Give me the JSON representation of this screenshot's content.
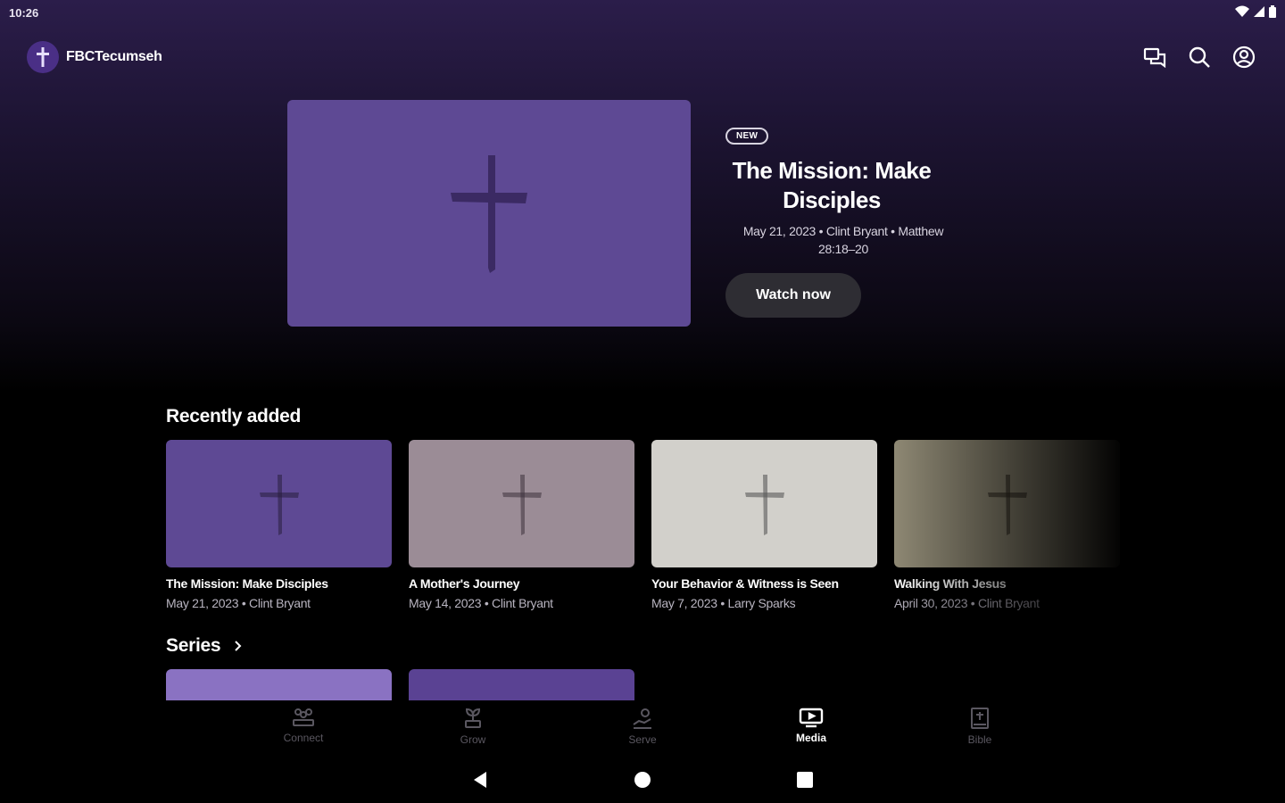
{
  "status_bar": {
    "time": "10:26"
  },
  "app": {
    "name": "FBCTecumseh"
  },
  "top_actions": [
    "messages-icon",
    "search-icon",
    "account-icon"
  ],
  "hero": {
    "badge": "NEW",
    "title": "The Mission: Make Disciples",
    "meta": "May 21, 2023 • Clint Bryant • Matthew 28:18–20",
    "cta": "Watch now",
    "thumb_color": "#5e4994"
  },
  "recently_added": {
    "title": "Recently added",
    "items": [
      {
        "title": "The Mission: Make Disciples",
        "meta": "May 21, 2023 • Clint Bryant",
        "color": "#5e4994"
      },
      {
        "title": "A Mother's Journey",
        "meta": "May 14, 2023 • Clint Bryant",
        "color": "#9b8c96"
      },
      {
        "title": "Your Behavior & Witness is Seen",
        "meta": "May 7, 2023 • Larry Sparks",
        "color": "#d2d0cb"
      },
      {
        "title": "Walking With Jesus",
        "meta": "April 30, 2023 • Clint Bryant",
        "color": "#918b76"
      }
    ]
  },
  "series": {
    "title": "Series",
    "colors": [
      "#8a72c2",
      "#5a4293"
    ]
  },
  "bottom_nav": {
    "items": [
      {
        "label": "Connect",
        "icon": "connect-icon"
      },
      {
        "label": "Grow",
        "icon": "grow-icon"
      },
      {
        "label": "Serve",
        "icon": "serve-icon"
      },
      {
        "label": "Media",
        "icon": "media-icon",
        "active": true
      },
      {
        "label": "Bible",
        "icon": "bible-icon"
      }
    ]
  },
  "colors": {
    "accent": "#5e4994",
    "background": "#000000",
    "header": "#2b1d4a"
  }
}
